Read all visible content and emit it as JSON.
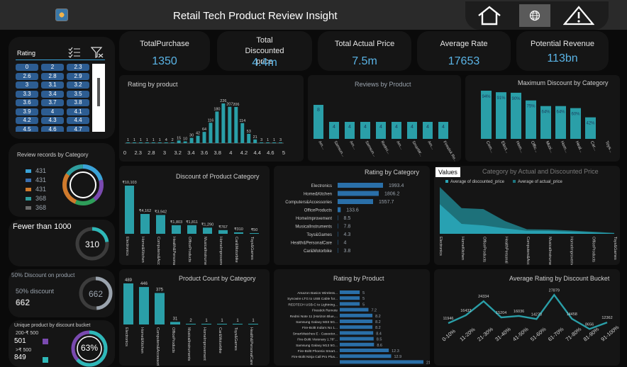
{
  "app": {
    "title": "Retail Tech Product Review  Insight"
  },
  "kpis": [
    {
      "label": "TotalPurchase",
      "value": "1350"
    },
    {
      "label": "Total Discounted price",
      "value": "4.4m"
    },
    {
      "label": "Total  Actual Price",
      "value": "7.5m"
    },
    {
      "label": "Average Rate",
      "value": "17653"
    },
    {
      "label": "Potential Revenue",
      "value": "113bn"
    }
  ],
  "rating_slicer": {
    "title": "Rating",
    "rows": [
      [
        "0",
        "2",
        "2.3"
      ],
      [
        "2.6",
        "2.8",
        "2.9"
      ],
      [
        "3",
        "3.1",
        "3.2"
      ],
      [
        "3.3",
        "3.4",
        "3.5"
      ],
      [
        "3.6",
        "3.7",
        "3.8"
      ],
      [
        "3.9",
        "4",
        "4.1"
      ],
      [
        "4.2",
        "4.3",
        "4.4"
      ],
      [
        "4.5",
        "4.6",
        "4.7"
      ]
    ]
  },
  "review_records": {
    "title": "Review records by Category",
    "values": [
      "431",
      "431",
      "431",
      "368",
      "368"
    ],
    "colors": [
      "#3aa3d8",
      "#3a6fb0",
      "#d07a2c",
      "#2e9e9e",
      "#6a6a6a"
    ]
  },
  "fewer_than": {
    "title": "Fewer than 1000",
    "value": "310",
    "fraction": 0.23
  },
  "discount_product": {
    "title": "50%  Discount on product",
    "label": "50% discount",
    "value": "662",
    "gauge_value": "662",
    "fraction": 0.49
  },
  "unique_bucket": {
    "title": "Unique product by discount bucket",
    "row1_label": "200-₹ 500",
    "row1_value": "501",
    "row2_label": ">₹ 500",
    "row2_value": "849",
    "percent": "63%",
    "fraction": 0.63
  },
  "rating_by_product": {
    "title": "Rating by product",
    "chart_data": {
      "type": "bar",
      "categories": [
        "0",
        "2",
        "2.3",
        "2.6",
        "2.8",
        "2.9",
        "3",
        "3.1",
        "3.2",
        "3.3",
        "3.4",
        "3.5",
        "3.6",
        "3.7",
        "3.8",
        "3.9",
        "4",
        "4.1",
        "4.2",
        "4.3",
        "4.4",
        "4.5",
        "4.6",
        "4.7",
        "5"
      ],
      "values": [
        1,
        1,
        1,
        1,
        1,
        1,
        4,
        2,
        15,
        10,
        30,
        42,
        64,
        116,
        180,
        226,
        207,
        206,
        114,
        53,
        21,
        3,
        1,
        1,
        3
      ],
      "ticks": [
        "0",
        "2.3",
        "2.8",
        "3",
        "3.2",
        "3.4",
        "3.6",
        "3.8",
        "4",
        "4.2",
        "4.4",
        "4.6",
        "5"
      ]
    }
  },
  "reviews_by_product": {
    "title": "Reviews by Product",
    "chart_data": {
      "type": "bar",
      "categories": [
        "Am...",
        "Samsun...",
        "Am...",
        "Samsun...",
        "Redmi...",
        "Am...",
        "SmartW...",
        "Am...",
        "Firestick Re..."
      ],
      "values": [
        8,
        4,
        4,
        4,
        4,
        4,
        4,
        4,
        4
      ]
    }
  },
  "max_discount": {
    "title": "Maximum Discount by Category",
    "chart_data": {
      "type": "bar",
      "categories": [
        "Com...",
        "Elect...",
        "Hom...",
        "Offic...",
        "Musi...",
        "Hom...",
        "Heal...",
        "Car...",
        "Toys..."
      ],
      "values": [
        94,
        91,
        90,
        75,
        64,
        64,
        60,
        42,
        0
      ],
      "labels": [
        "94%",
        "91%",
        "90%",
        "75%",
        "64%",
        "64%",
        "60%",
        "42%",
        ""
      ]
    }
  },
  "discount_category": {
    "title": "Discount of Product Category",
    "chart_data": {
      "type": "bar",
      "categories": [
        "Electronics",
        "Home&Kitchen",
        "Computers&Accessories",
        "Health&PersonalCare",
        "OfficeProducts",
        "MusicalInstruments",
        "HomeImprovement",
        "Car&Motorbike",
        "Toys&Games"
      ],
      "values": [
        10103,
        4162,
        3942,
        1803,
        1811,
        1290,
        767,
        310,
        50
      ],
      "labels": [
        "₹10,103",
        "₹4,162",
        "₹3,942",
        "₹1,803",
        "₹1,811",
        "₹1,290",
        "₹767",
        "₹310",
        "₹50"
      ]
    }
  },
  "rating_category": {
    "title": "Rating by Category",
    "chart_data": {
      "type": "bar",
      "categories": [
        "Electronics",
        "Home&Kitchen",
        "Computers&Accessories",
        "OfficeProducts",
        "HomeImprovement",
        "MusicalInstruments",
        "Toys&Games",
        "Health&PersonalCare",
        "Car&Motorbike"
      ],
      "values": [
        1993.4,
        1806.2,
        1557.7,
        133.6,
        8.5,
        7.8,
        4.3,
        4,
        3.8
      ]
    }
  },
  "category_actual_discount": {
    "title": "Category  by Actual and Discounted Price",
    "values_button": "Values",
    "legend": [
      "Average of discounted_price",
      "Average of actual_price"
    ],
    "chart_data": {
      "type": "area",
      "categories": [
        "Electronics",
        "HomeKitchen",
        "OfficeProducts",
        "HealthPersonal",
        "Computers&Accessories",
        "MusicalInstruments",
        "HomeImprovement",
        "OfficeProducts",
        "Toys&Games"
      ],
      "series": [
        {
          "name": "Average of discounted_price",
          "values": [
            9800,
            3300,
            2800,
            1800,
            1000,
            950,
            700,
            420,
            150
          ]
        },
        {
          "name": "Average of actual_price",
          "values": [
            15500,
            8500,
            8200,
            4200,
            1500,
            1400,
            1100,
            700,
            300
          ]
        }
      ]
    }
  },
  "product_count": {
    "title": "Product Count by Category",
    "chart_data": {
      "type": "bar",
      "categories": [
        "Electronics",
        "Home&Kitchen",
        "Computers&Accessories",
        "OfficeProducts",
        "MusicalInstruments",
        "HomeImprovement",
        "Car&Motorbike",
        "Toys&Games",
        "Health&PersonalCare"
      ],
      "values": [
        489,
        446,
        375,
        31,
        2,
        1,
        1,
        1,
        1
      ]
    }
  },
  "rating_product": {
    "title": "Rating by Product",
    "chart_data": {
      "type": "bar",
      "categories": [
        "Amazon Basics Wireless...",
        "Syncwire LTG to USB Cable for...",
        "REDTECH USB-C to Lightning...",
        "Firestick Remote",
        "Redmi Note 11 (Horizon Blue,...",
        "Samsung Galaxy M33 5G...",
        "Fire-Boltt India's No 1...",
        "SmartWatches E - Caseetor...",
        "Fire-Boltt Visionary 1.78\"...",
        "Samsung Galaxy M13 5G...",
        "Fire-Boltt Phoenix Smart...",
        "Fire-Boltt Ninja Call Pro Plus..."
      ],
      "values": [
        5,
        5,
        5,
        7.2,
        8.2,
        8.2,
        8.2,
        8.4,
        8.5,
        8.6,
        12.3,
        12.9,
        21
      ]
    }
  },
  "avg_rating_bucket": {
    "title": "Average Rating by Discount Bucket",
    "chart_data": {
      "type": "line",
      "categories": [
        "0-10%",
        "11-20%",
        "21-30%",
        "31-40%",
        "41-50%",
        "51-60%",
        "61-70%",
        "71-80%",
        "81-90%",
        "91-100%"
      ],
      "values": [
        11946,
        16433,
        24334,
        15204,
        16036,
        14270,
        27879,
        14458,
        8656,
        12362
      ]
    }
  }
}
